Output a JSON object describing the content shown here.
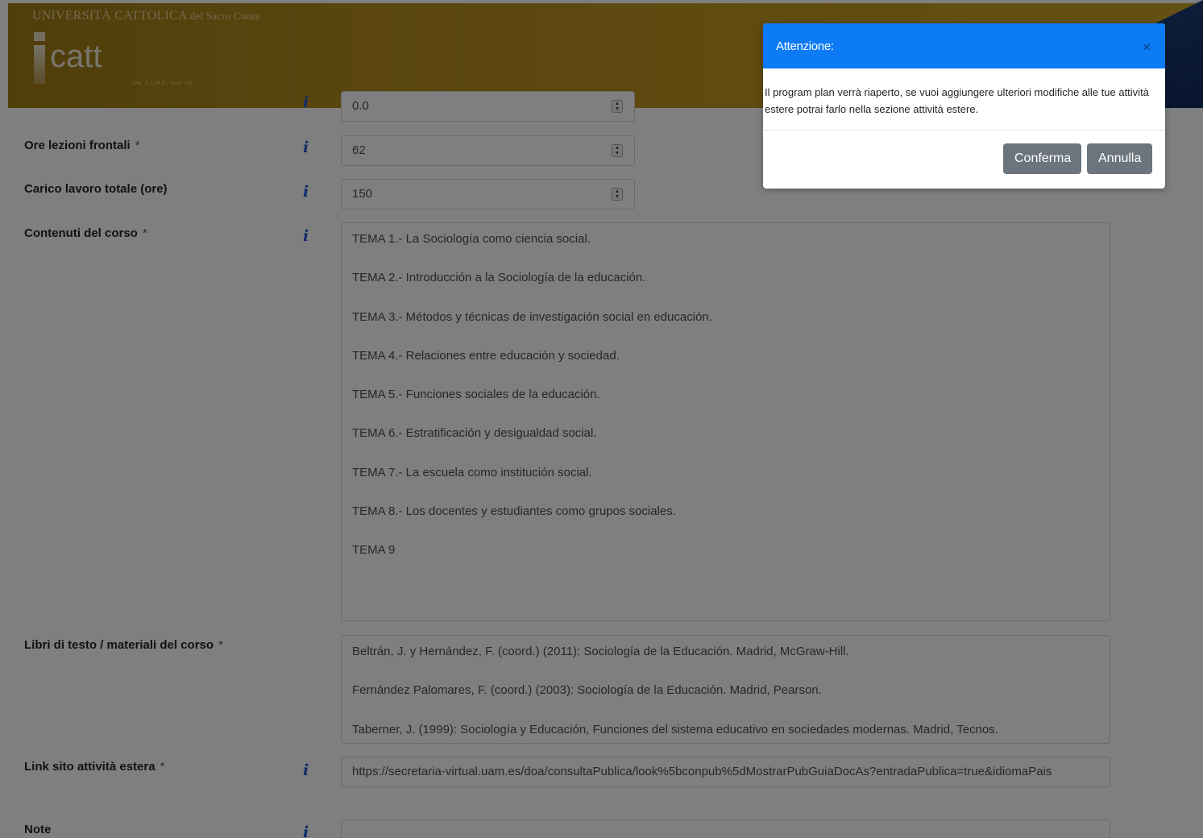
{
  "header": {
    "university": "UNIVERSITÀ CATTOLICA",
    "university_suffix": "del Sacro Cuore",
    "logo": "catt",
    "version": "(Ver. 2.7.18 () - Host: 10)"
  },
  "form": {
    "partial_field_value": "0.0",
    "ore_lezioni": {
      "label": "Ore lezioni frontali",
      "required": "*",
      "value": "62"
    },
    "carico_lavoro": {
      "label": "Carico lavoro totale (ore)",
      "value": "150"
    },
    "contenuti": {
      "label": "Contenuti del corso",
      "required": "*",
      "lines": [
        "TEMA 1.- La Sociología como ciencia social.",
        "TEMA 2.- Introducción a la Sociología de la educación.",
        "TEMA 3.- Métodos y técnicas de investigación social en educación.",
        "TEMA 4.- Relaciones entre educación y sociedad.",
        "TEMA 5.- Funciones sociales de la educación.",
        "TEMA 6.- Estratificación y desigualdad social.",
        "TEMA 7.- La escuela como institución social.",
        "TEMA 8.- Los docentes y estudiantes como grupos sociales.",
        "TEMA 9"
      ]
    },
    "libri": {
      "label": "Libri di testo / materiali del corso",
      "required": "*",
      "lines": [
        "Beltrán, J. y Hernández, F. (coord.) (2011): Sociología de la Educación. Madrid, McGraw-Hill.",
        "Fernández Palomares, F. (coord.) (2003): Sociología de la Educación. Madrid, Pearson.",
        "Taberner, J. (1999): Sociología y Educación, Funciones del sistema educativo en sociedades modernas. Madrid, Tecnos."
      ]
    },
    "link": {
      "label": "Link sito attività estera",
      "required": "*",
      "value": "https://secretaria-virtual.uam.es/doa/consultaPublica/look%5bconpub%5dMostrarPubGuiaDocAs?entradaPublica=true&idiomaPais"
    },
    "note": {
      "label": "Note"
    }
  },
  "modal": {
    "title": "Attenzione:",
    "close_icon": "×",
    "message": "Il program plan verrà riaperto, se vuoi aggiungere ulteriori modifiche alle tue attività estere potrai farlo nella sezione attività estere.",
    "confirm_label": "Conferma",
    "cancel_label": "Annulla"
  },
  "colors": {
    "modal_header": "#0d7bf5",
    "button": "#6c757d",
    "info_icon": "#1f5bd6"
  }
}
